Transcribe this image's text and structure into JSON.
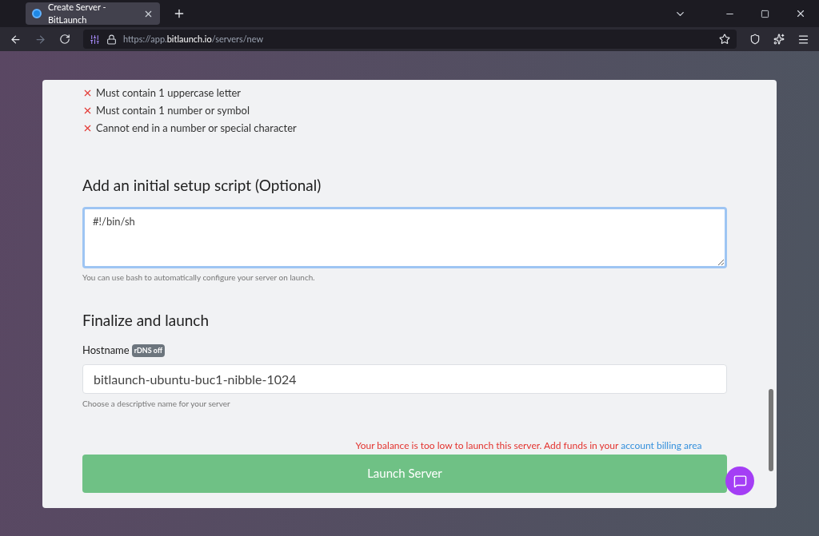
{
  "browser": {
    "tab": {
      "title": "Create Server - BitLaunch",
      "selected": true
    },
    "url": {
      "prefix": "https://app.",
      "domain": "bitlaunch.io",
      "path": "/servers/new"
    }
  },
  "password_rules": [
    {
      "text": "Must contain 1 uppercase letter",
      "met": false
    },
    {
      "text": "Must contain 1 number or symbol",
      "met": false
    },
    {
      "text": "Cannot end in a number or special character",
      "met": false
    }
  ],
  "setup_script": {
    "heading": "Add an initial setup script (Optional)",
    "value": "#!/bin/sh",
    "help": "You can use bash to automatically configure your server on launch."
  },
  "finalize": {
    "heading": "Finalize and launch",
    "hostname_label": "Hostname",
    "badge": "rDNS off",
    "hostname_value": "bitlaunch-ubuntu-buc1-nibble-1024",
    "help": "Choose a descriptive name for your server"
  },
  "balance_warning": {
    "text": "Your balance is too low to launch this server. Add funds in your",
    "link": "account billing area"
  },
  "launch_button": {
    "label": "Launch Server",
    "disabled": true
  }
}
